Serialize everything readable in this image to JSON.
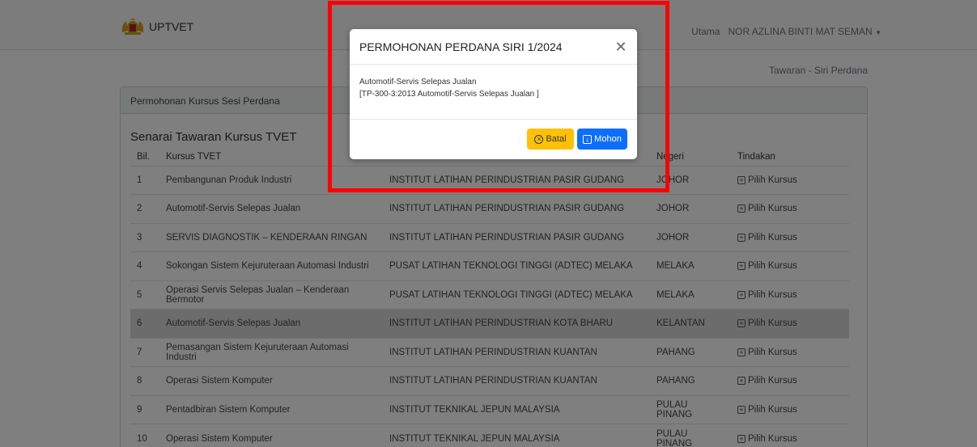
{
  "navbar": {
    "brand": "UPTVET",
    "home_link": "Utama",
    "user_name": "NOR AZLINA BINTI MAT SEMAN"
  },
  "breadcrumb": "Tawaran - Siri Perdana",
  "card": {
    "header": "Permohonan Kursus Sesi Perdana",
    "list_title": "Senarai Tawaran Kursus TVET",
    "columns": {
      "no": "Bil.",
      "course": "Kursus TVET",
      "institute": "",
      "state": "Negeri",
      "action": "Tindakan"
    },
    "rows": [
      {
        "no": "1",
        "course": "Pembangunan Produk Industri",
        "institute": "INSTITUT LATIHAN PERINDUSTRIAN PASIR GUDANG",
        "state": "JOHOR",
        "action": "Pilih Kursus"
      },
      {
        "no": "2",
        "course": "Automotif-Servis Selepas Jualan",
        "institute": "INSTITUT LATIHAN PERINDUSTRIAN PASIR GUDANG",
        "state": "JOHOR",
        "action": "Pilih Kursus"
      },
      {
        "no": "3",
        "course": "SERVIS DIAGNOSTIK – KENDERAAN RINGAN",
        "institute": "INSTITUT LATIHAN PERINDUSTRIAN PASIR GUDANG",
        "state": "JOHOR",
        "action": "Pilih Kursus"
      },
      {
        "no": "4",
        "course": "Sokongan Sistem Kejuruteraan Automasi Industri",
        "institute": "PUSAT LATIHAN TEKNOLOGI TINGGI (ADTEC) MELAKA",
        "state": "MELAKA",
        "action": "Pilih Kursus"
      },
      {
        "no": "5",
        "course": "Operasi Servis Selepas Jualan – Kenderaan Bermotor",
        "institute": "PUSAT LATIHAN TEKNOLOGI TINGGI (ADTEC) MELAKA",
        "state": "MELAKA",
        "action": "Pilih Kursus"
      },
      {
        "no": "6",
        "course": "Automotif-Servis Selepas Jualan",
        "institute": "INSTITUT LATIHAN PERINDUSTRIAN KOTA BHARU",
        "state": "KELANTAN",
        "action": "Pilih Kursus"
      },
      {
        "no": "7",
        "course": "Pemasangan Sistem Kejuruteraan Automasi Industri",
        "institute": "INSTITUT LATIHAN PERINDUSTRIAN KUANTAN",
        "state": "PAHANG",
        "action": "Pilih Kursus"
      },
      {
        "no": "8",
        "course": "Operasi Sistem Komputer",
        "institute": "INSTITUT LATIHAN PERINDUSTRIAN KUANTAN",
        "state": "PAHANG",
        "action": "Pilih Kursus"
      },
      {
        "no": "9",
        "course": "Pentadbiran Sistem Komputer",
        "institute": "INSTITUT TEKNIKAL JEPUN MALAYSIA",
        "state": "PULAU PINANG",
        "action": "Pilih Kursus"
      },
      {
        "no": "10",
        "course": "Operasi Sistem Komputer",
        "institute": "INSTITUT TEKNIKAL JEPUN MALAYSIA",
        "state": "PULAU PINANG",
        "action": "Pilih Kursus"
      }
    ]
  },
  "modal": {
    "title": "PERMOHONAN PERDANA SIRI 1/2024",
    "course_name": "Automotif-Servis Selepas Jualan",
    "course_code": "[TP-300-3:2013 Automotif-Servis Selepas Jualan ]",
    "cancel_label": "Batal",
    "apply_label": "Mohon"
  },
  "colors": {
    "cancel": "#ffc107",
    "apply": "#0d6efd",
    "highlight": "#ff0000"
  }
}
